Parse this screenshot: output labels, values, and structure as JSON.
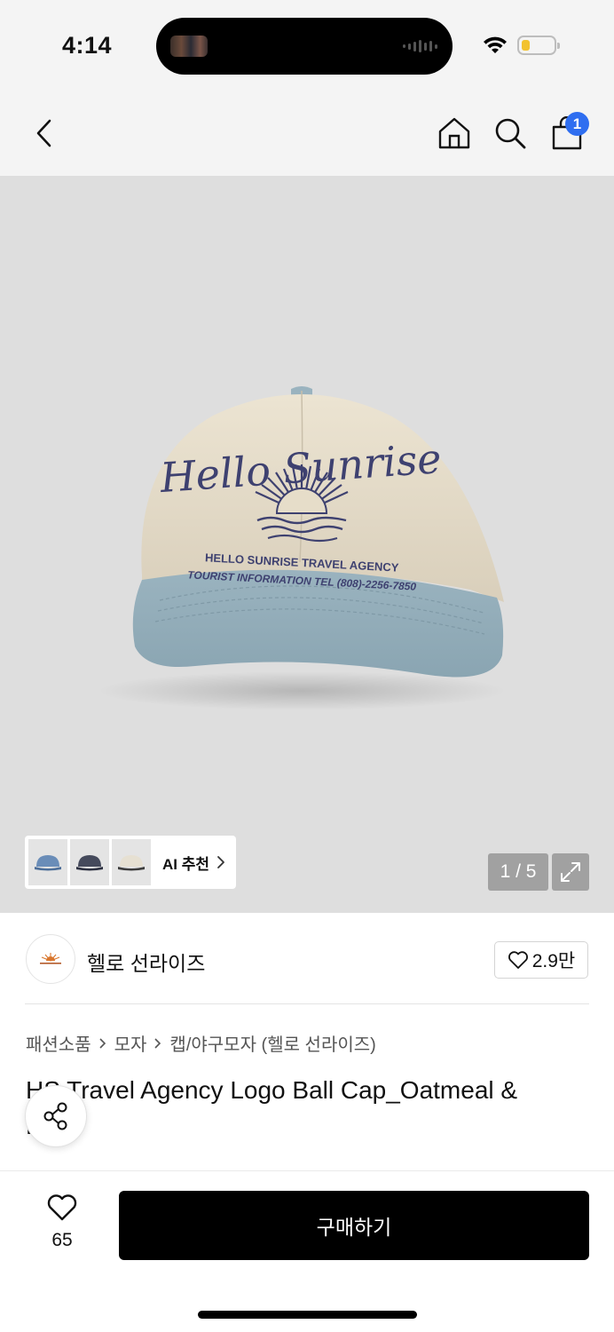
{
  "status": {
    "time": "4:14",
    "battery_level": 0.2
  },
  "nav": {
    "back_icon": "chevron-left-icon",
    "home_icon": "home-icon",
    "search_icon": "search-icon",
    "cart_icon": "shopping-bag-icon",
    "cart_count": "1",
    "badge_color": "#2f6ef0"
  },
  "gallery": {
    "ai_label": "AI 추천",
    "page_counter": "1 / 5",
    "thumbnails": [
      "blue-cap",
      "navy-cap",
      "oatmeal-cap"
    ]
  },
  "cap_embroidery": {
    "script": "Hello Sunrise",
    "line1": "HELLO SUNRISE TRAVEL AGENCY",
    "line2": "TOURIST INFORMATION  TEL (808)-2256-7850"
  },
  "brand": {
    "name": "헬로 선라이즈",
    "likes": "2.9만"
  },
  "breadcrumb": {
    "level1": "패션소품",
    "level2": "모자",
    "level3": "캡/야구모자 (헬로 선라이즈)"
  },
  "product": {
    "title": "HS Travel Agency Logo Ball Cap_Oatmeal &",
    "title_line2": "L"
  },
  "bottom": {
    "wish_count": "65",
    "buy_label": "구매하기"
  }
}
